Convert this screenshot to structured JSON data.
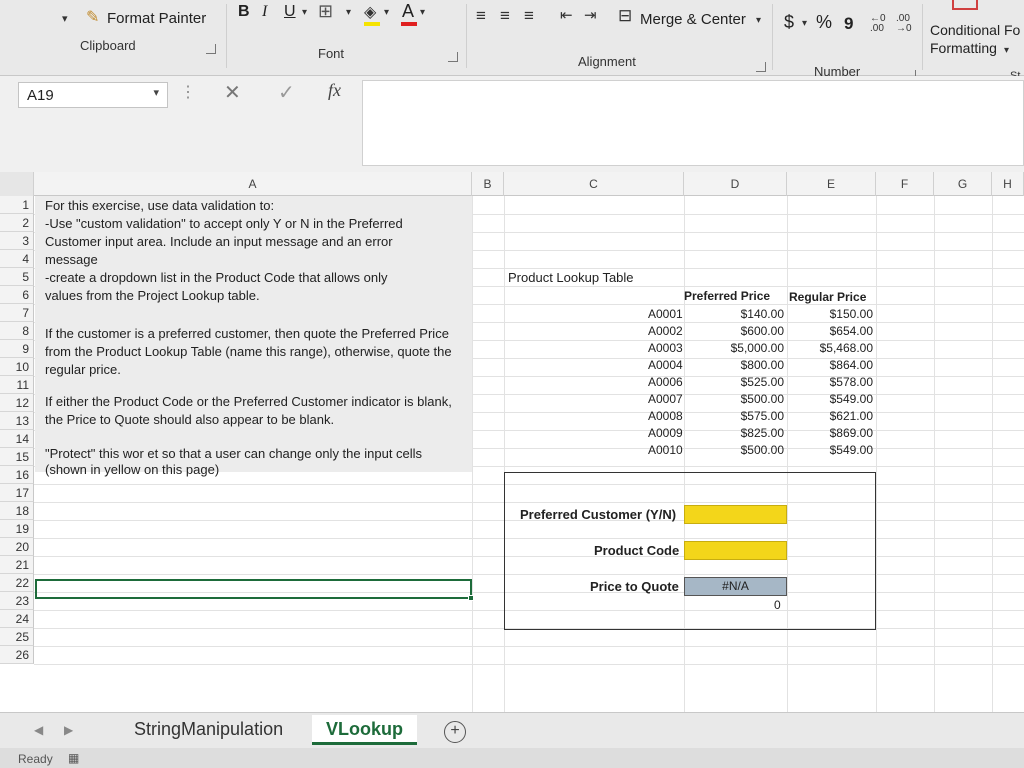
{
  "ribbon": {
    "format_painter": "Format Painter",
    "clipboard_label": "Clipboard",
    "font_label": "Font",
    "alignment_label": "Alignment",
    "number_label": "Number",
    "merge_center": "Merge & Center",
    "currency": "$",
    "percent": "%",
    "comma": "9",
    "conditional_line1": "Conditional Fo",
    "conditional_line2": "Formatting",
    "styles_partial": "St",
    "bold": "B",
    "italic": "I",
    "underline": "U",
    "font_color_letter": "A"
  },
  "formula_bar": {
    "name_box": "A19",
    "fx": "fx",
    "value": ""
  },
  "columns": [
    "A",
    "B",
    "C",
    "D",
    "E",
    "F",
    "G",
    "H"
  ],
  "rows": [
    "1",
    "2",
    "3",
    "4",
    "5",
    "6",
    "7",
    "8",
    "9",
    "10",
    "11",
    "12",
    "13",
    "14",
    "15",
    "16",
    "17",
    "18",
    "19",
    "20",
    "21",
    "22",
    "23",
    "24",
    "25",
    "26"
  ],
  "instructions": [
    "For this exercise, use data validation to:",
    "-Use \"custom validation\" to accept only Y or N in the Preferred",
    "Customer input area.  Include an input message and an error",
    "message",
    "-create a dropdown list in the Product Code that allows only",
    "values from the Project Lookup table.",
    "If the customer is a preferred customer, then quote the Preferred Price",
    "from the Product Lookup Table (name this range), otherwise, quote the",
    "regular price.",
    "If either the Product Code or the Preferred Customer indicator is blank,",
    "the Price to Quote should also appear to be blank.",
    "\"Protect\" this wor       et so that a user can change only the input cells",
    "(shown in yellow on this page)"
  ],
  "lookup": {
    "title": "Product Lookup Table",
    "header_preferred": "Preferred Price",
    "header_regular": "Regular Price",
    "rows": [
      {
        "code": "A0001",
        "preferred": "$140.00",
        "regular": "$150.00"
      },
      {
        "code": "A0002",
        "preferred": "$600.00",
        "regular": "$654.00"
      },
      {
        "code": "A0003",
        "preferred": "$5,000.00",
        "regular": "$5,468.00"
      },
      {
        "code": "A0004",
        "preferred": "$800.00",
        "regular": "$864.00"
      },
      {
        "code": "A0006",
        "preferred": "$525.00",
        "regular": "$578.00"
      },
      {
        "code": "A0007",
        "preferred": "$500.00",
        "regular": "$549.00"
      },
      {
        "code": "A0008",
        "preferred": "$575.00",
        "regular": "$621.00"
      },
      {
        "code": "A0009",
        "preferred": "$825.00",
        "regular": "$869.00"
      },
      {
        "code": "A0010",
        "preferred": "$500.00",
        "regular": "$549.00"
      }
    ]
  },
  "inputs": {
    "preferred_label": "Preferred Customer (Y/N)",
    "product_label": "Product Code",
    "quote_label": "Price to Quote",
    "quote_value": "#N/A",
    "zero_value": "0"
  },
  "tabs": {
    "sheet1": "StringManipulation",
    "sheet2": "VLookup",
    "add": "+"
  },
  "status": {
    "text": "Ready"
  },
  "colors": {
    "input_yellow": "#f3d61a",
    "quote_fill": "#a6b7c6",
    "excel_green": "#1d6b3a"
  }
}
